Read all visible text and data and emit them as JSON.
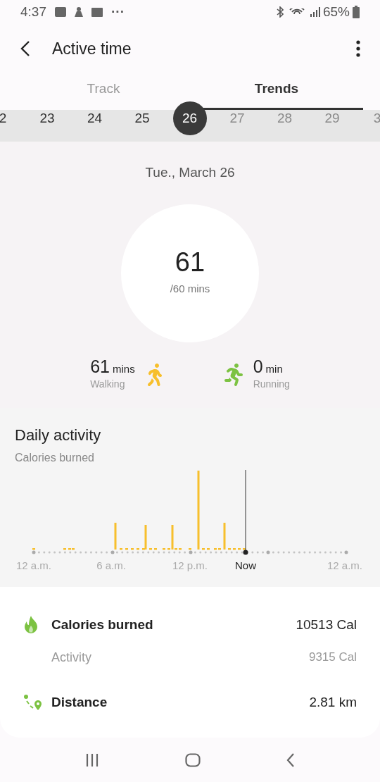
{
  "status_bar": {
    "time": "4:37",
    "more": "···",
    "battery": "65%"
  },
  "header": {
    "title": "Active time"
  },
  "tabs": [
    {
      "label": "Track",
      "selected": false
    },
    {
      "label": "Trends",
      "selected": true
    }
  ],
  "days": [
    {
      "label": "2",
      "selected": false,
      "disabled": false
    },
    {
      "label": "23",
      "selected": false,
      "disabled": false
    },
    {
      "label": "24",
      "selected": false,
      "disabled": false
    },
    {
      "label": "25",
      "selected": false,
      "disabled": false
    },
    {
      "label": "26",
      "selected": true,
      "disabled": false
    },
    {
      "label": "27",
      "selected": false,
      "disabled": true
    },
    {
      "label": "28",
      "selected": false,
      "disabled": true
    },
    {
      "label": "29",
      "selected": false,
      "disabled": true
    },
    {
      "label": "3",
      "selected": false,
      "disabled": true
    }
  ],
  "date": "Tue., March 26",
  "ring": {
    "value": "61",
    "goal": "/60 mins"
  },
  "activities": [
    {
      "kind": "walking",
      "value": "61",
      "unit": "mins",
      "label": "Walking"
    },
    {
      "kind": "running",
      "value": "0",
      "unit": "min",
      "label": "Running"
    }
  ],
  "daily_activity": {
    "title": "Daily activity",
    "subtitle": "Calories burned",
    "axis_labels": [
      {
        "label": "12 a.m.",
        "kind": "tick"
      },
      {
        "label": "6 a.m.",
        "kind": "tick"
      },
      {
        "label": "12 p.m.",
        "kind": "tick"
      },
      {
        "label": "Now",
        "kind": "now"
      },
      {
        "label": "12 a.m.",
        "kind": "tick"
      }
    ]
  },
  "summary": [
    {
      "kind": "calories",
      "label": "Calories burned",
      "value": "10513 Cal",
      "sub_label": "Activity",
      "sub_value": "9315 Cal"
    },
    {
      "kind": "distance",
      "label": "Distance",
      "value": "2.81 km"
    }
  ]
}
